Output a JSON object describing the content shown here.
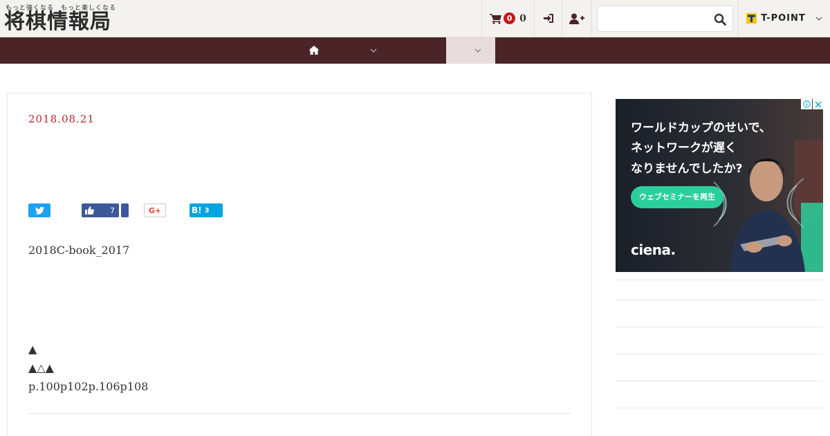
{
  "header": {
    "logo": {
      "tagline": "もっと強くなる　もっと楽しくなる",
      "title": "将棋情報局"
    },
    "cart": {
      "icon": "cart-icon",
      "badge": "0",
      "total": "0"
    },
    "login": {
      "icon": "sign-in-icon"
    },
    "register": {
      "icon": "user-plus-icon"
    },
    "search": {
      "value": "",
      "icon": "search-icon"
    },
    "tpoint": {
      "label": "T-POINT",
      "icon": "chevron-down-icon"
    }
  },
  "nav": {
    "home_icon": "home-icon",
    "caret_icon": "chevron-down-icon",
    "active_bg": "#e8dcdc",
    "bar_color": "#4a2427"
  },
  "article": {
    "date": "2018.08.21",
    "share": {
      "twitter_icon": "twitter-icon",
      "facebook_icon": "thumbs-up-icon",
      "facebook_count": "7",
      "googleplus_label": "G+",
      "hatena_label": "B!",
      "hatena_count": "3"
    },
    "filename": "2018C-book_2017",
    "line_triangle": "▲",
    "line_triangles": "▲△▲",
    "line_pages": "p.100p102p.106p108"
  },
  "sidebar": {
    "ad": {
      "line1": "ワールドカップのせいで、",
      "line2": "ネットワークが遅く",
      "line3": "なりませんでしたか?",
      "cta": "ウェブセミナーを再生",
      "brand": "ciena.",
      "info_icon": "info-icon",
      "close_icon": "close-icon"
    }
  },
  "colors": {
    "accent": "#b5262e",
    "badge": "#c8161d",
    "twitter": "#1da1f2",
    "facebook": "#3b5998",
    "hatena": "#00a4de",
    "ad_cta": "#2ccf9b"
  }
}
